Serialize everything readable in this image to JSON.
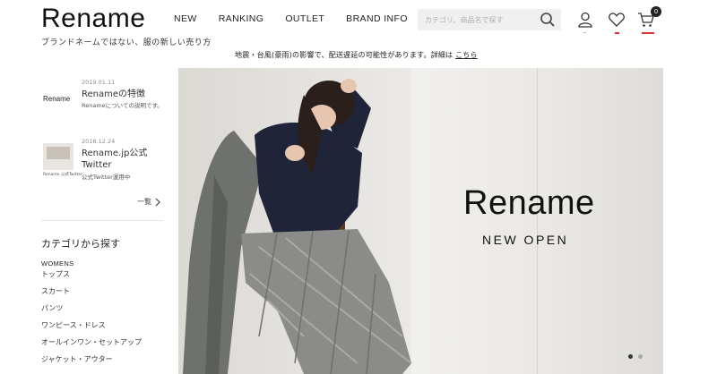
{
  "header": {
    "logo": "Rename",
    "tagline": "ブランドネームではない、服の新しい売り方",
    "nav": [
      "NEW",
      "RANKING",
      "OUTLET",
      "BRAND INFO"
    ],
    "search_placeholder": "カテゴリ、商品名で探す",
    "cart_count": "0"
  },
  "notice": {
    "text": "地震・台風(豪雨)の影響で、配送遅延の可能性があります。詳細は",
    "link": "こちら"
  },
  "sidebar": {
    "posts": [
      {
        "date": "2019.01.11",
        "title": "Renameの特徴",
        "desc": "Renameについての説明です。",
        "thumb_text": "Rename"
      },
      {
        "date": "2018.12.24",
        "title": "Rename.jp公式Twitter",
        "desc": "公式Twitter運用中",
        "thumb_caption": "Rename 公式Twitter"
      }
    ],
    "more": "一覧",
    "category_title": "カテゴリから探す",
    "category_group": "WOMENS",
    "categories": [
      "トップス",
      "スカート",
      "パンツ",
      "ワンピース・ドレス",
      "オールインワン・セットアップ",
      "ジャケット・アウター"
    ]
  },
  "hero": {
    "title": "Rename",
    "subtitle": "NEW OPEN",
    "slide_count": 2,
    "active_slide": 1
  }
}
